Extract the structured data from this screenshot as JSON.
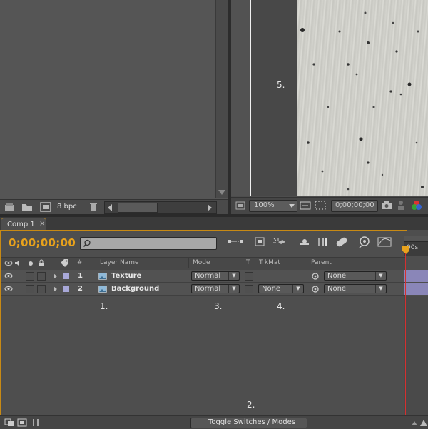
{
  "project_panel": {
    "bpc_label": "8 bpc"
  },
  "viewer": {
    "annotation": "5.",
    "zoom": "100%",
    "timecode": "0;00;00;00"
  },
  "timeline": {
    "tab_label": "Comp 1",
    "timecode": "0;00;00;00",
    "search_placeholder": "",
    "ruler_label": "00s",
    "columns": {
      "number": "#",
      "layer_name": "Layer Name",
      "mode": "Mode",
      "t": "T",
      "trkmat": "TrkMat",
      "parent": "Parent"
    },
    "layers": [
      {
        "number": "1",
        "name": "Texture",
        "mode": "Normal",
        "trkmat": "",
        "parent": "None"
      },
      {
        "number": "2",
        "name": "Background",
        "mode": "Normal",
        "trkmat": "None",
        "parent": "None"
      }
    ],
    "annotations": [
      "1.",
      "2.",
      "3.",
      "4."
    ],
    "toggle_label": "Toggle Switches / Modes"
  },
  "colors": {
    "accent_orange": "#e8a21c",
    "playhead_red": "#d43030",
    "label_lavender": "#a8a8d8"
  }
}
